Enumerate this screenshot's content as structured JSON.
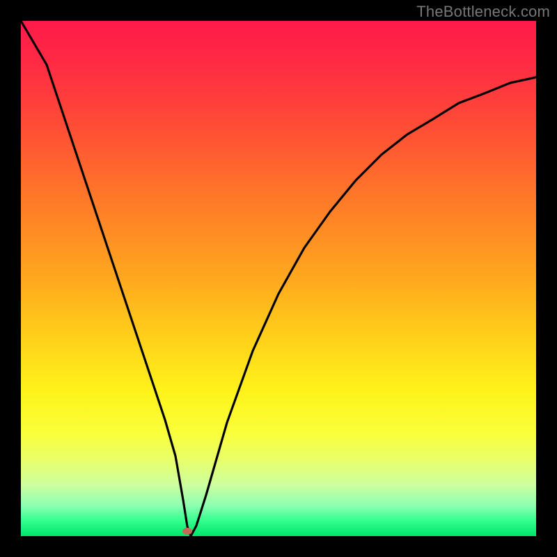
{
  "watermark": "TheBottleneck.com",
  "chart_data": {
    "type": "line",
    "title": "",
    "xlabel": "",
    "ylabel": "",
    "xlim": [
      0,
      100
    ],
    "ylim": [
      0,
      100
    ],
    "series": [
      {
        "name": "curve",
        "x": [
          0,
          5,
          10,
          15,
          20,
          25,
          28,
          30,
          32,
          33,
          34,
          36,
          40,
          45,
          50,
          55,
          60,
          65,
          70,
          75,
          80,
          85,
          90,
          95,
          100
        ],
        "values": [
          100,
          85,
          70,
          55,
          40,
          25,
          15,
          8,
          1,
          0,
          2,
          8,
          22,
          36,
          47,
          56,
          63,
          69,
          74,
          78,
          81,
          84,
          86,
          88,
          89
        ]
      }
    ],
    "minimum_point": {
      "x": 33,
      "y": 0
    },
    "background_gradient": {
      "stops": [
        {
          "pos": 0.0,
          "color": "#ff1a4a"
        },
        {
          "pos": 0.35,
          "color": "#ff7a28"
        },
        {
          "pos": 0.62,
          "color": "#ffd21a"
        },
        {
          "pos": 0.8,
          "color": "#f9ff3a"
        },
        {
          "pos": 0.94,
          "color": "#8fffb2"
        },
        {
          "pos": 1.0,
          "color": "#00e56b"
        }
      ]
    },
    "minimum_marker_color": "#c56a56"
  }
}
